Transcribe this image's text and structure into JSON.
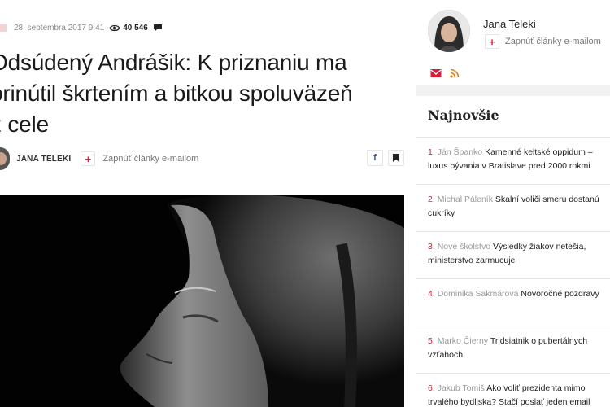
{
  "article": {
    "date": "28. septembra 2017 9:41",
    "views": "40 546",
    "headline_lines": [
      "Odsúdený Andrášik: K priznaniu ma",
      "prinútil škrtením a bitkou spoluväzeň",
      "z cele"
    ],
    "author": "JANA TELEKI",
    "subscribe_label": "Zapnúť články e-mailom",
    "plus_symbol": "+"
  },
  "sidebar": {
    "author_name": "Jana Teleki",
    "subscribe_label": "Zapnúť články e-mailom",
    "plus_symbol": "+",
    "latest_title": "Najnovšie",
    "items": [
      {
        "num": "1.",
        "author": "Ján Španko",
        "title": "Kamenné keltské oppidum – luxus bývania v Bratislave pred 2000 rokmi"
      },
      {
        "num": "2.",
        "author": "Michal Páleník",
        "title": "Skalní voliči smeru dostanú cukríky"
      },
      {
        "num": "3.",
        "author": "Nové školstvo",
        "title": "Výsledky žiakov netešia, ministerstvo zarmucuje"
      },
      {
        "num": "4.",
        "author": "Dominika Sakmárová",
        "title": "Novoročné pozdravy"
      },
      {
        "num": "5.",
        "author": "Marko Čierny",
        "title": "Tridsiatnik o pubertálnych vzťahoch"
      },
      {
        "num": "6.",
        "author": "Jakub Tomiš",
        "title": "Ako voliť prezidenta mimo trvalého bydliska? Stačí poslať jeden email"
      }
    ]
  },
  "colors": {
    "accent": "#d61d3c",
    "muted": "#8a8a8a",
    "sidebar_bg": "#f2f2f2"
  },
  "icons": [
    "eye-icon",
    "comment-icon",
    "plus-icon",
    "facebook-icon",
    "bookmark-icon",
    "mail-icon",
    "rss-icon"
  ]
}
